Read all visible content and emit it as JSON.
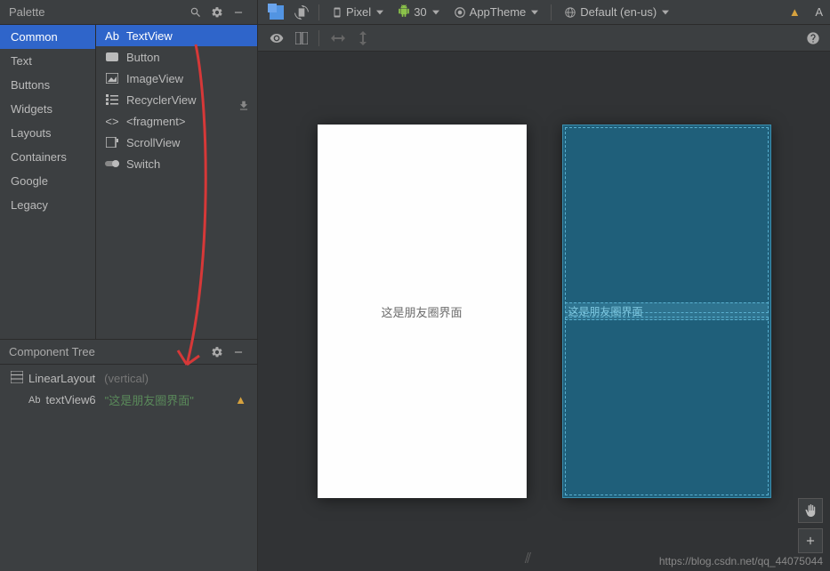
{
  "palette": {
    "title": "Palette",
    "categories": [
      "Common",
      "Text",
      "Buttons",
      "Widgets",
      "Layouts",
      "Containers",
      "Google",
      "Legacy"
    ],
    "selected_category": "Common",
    "items": [
      {
        "icon": "textview",
        "label": "TextView"
      },
      {
        "icon": "button",
        "label": "Button"
      },
      {
        "icon": "image",
        "label": "ImageView"
      },
      {
        "icon": "list",
        "label": "RecyclerView"
      },
      {
        "icon": "code",
        "label": "<fragment>"
      },
      {
        "icon": "scroll",
        "label": "ScrollView"
      },
      {
        "icon": "switch",
        "label": "Switch"
      }
    ],
    "selected_item": "TextView"
  },
  "component_tree": {
    "title": "Component Tree",
    "root": {
      "label": "LinearLayout",
      "hint": "(vertical)"
    },
    "child": {
      "label": "textView6",
      "text": "\"这是朋友圈界面\""
    }
  },
  "toolbar": {
    "device": "Pixel",
    "api": "30",
    "theme": "AppTheme",
    "locale": "Default (en-us)",
    "attr_label": "A"
  },
  "preview": {
    "text": "这是朋友圈界面"
  },
  "watermark": "https://blog.csdn.net/qq_44075044"
}
